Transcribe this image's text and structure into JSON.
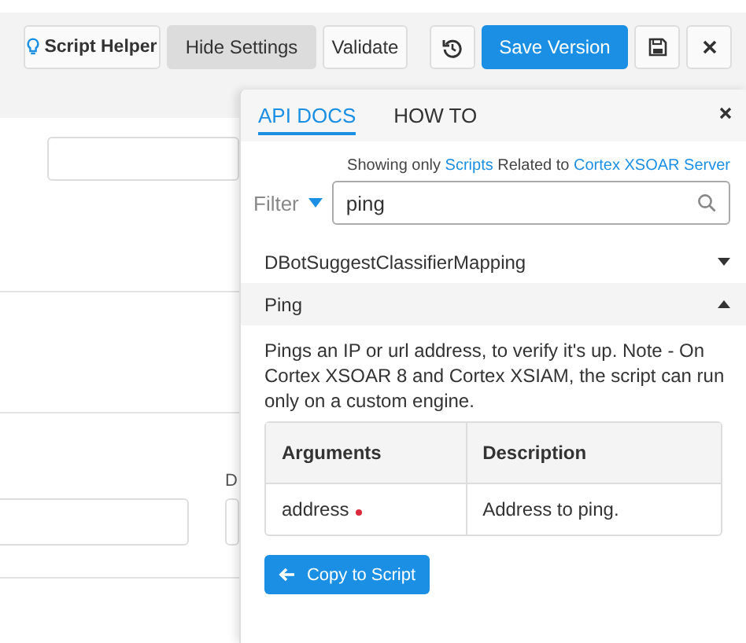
{
  "toolbar": {
    "buttons": [
      {
        "kind": "helper",
        "label": "Script Helper"
      },
      {
        "kind": "pressed",
        "label": "Hide Settings"
      },
      {
        "kind": "plain",
        "label": "Validate"
      },
      {
        "kind": "history"
      },
      {
        "kind": "primary",
        "label": "Save Version"
      },
      {
        "kind": "save"
      },
      {
        "kind": "close"
      }
    ]
  },
  "background": {
    "field_label_fragment": "D"
  },
  "docs_panel": {
    "tabs": [
      {
        "label": "API DOCS",
        "selected": true
      },
      {
        "label": "HOW TO",
        "selected": false
      }
    ],
    "scope": {
      "prefix": "Showing only",
      "type_link": "Scripts",
      "middle": "Related to",
      "server_link": "Cortex XSOAR Server"
    },
    "filter": {
      "label": "Filter",
      "value": "ping"
    },
    "scripts": [
      {
        "name": "DBotSuggestClassifierMapping",
        "expanded": false
      },
      {
        "name": "Ping",
        "expanded": true,
        "description": "Pings an IP or url address, to verify it's up. Note - On Cortex XSOAR 8 and Cortex XSIAM, the script can run only on a custom engine.",
        "arguments": {
          "columns": [
            "Arguments",
            "Description"
          ],
          "rows": [
            {
              "name": "address",
              "required": true,
              "description": "Address to ping."
            }
          ]
        },
        "copy_button": "Copy to Script"
      }
    ]
  }
}
